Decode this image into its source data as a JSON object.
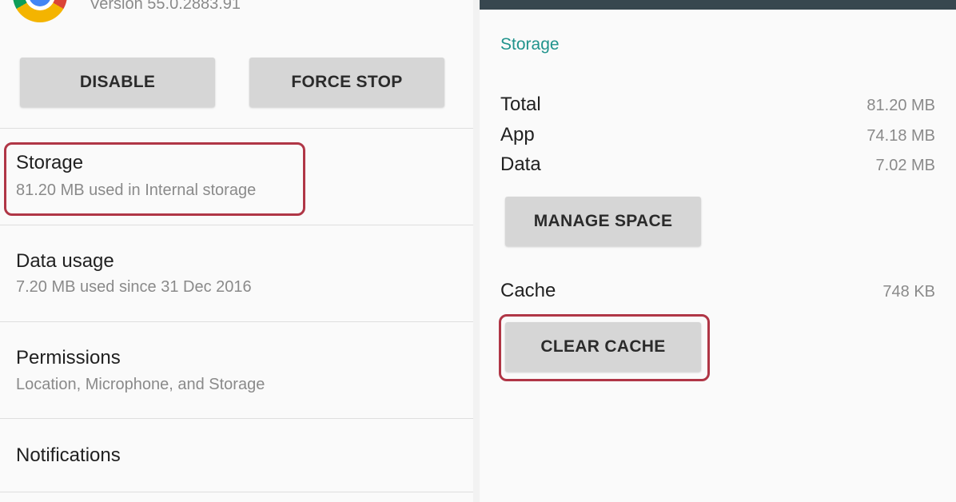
{
  "app_info": {
    "version": "Version 55.0.2883.91",
    "icon": "chrome-icon"
  },
  "buttons": {
    "disable": "DISABLE",
    "force_stop": "FORCE STOP"
  },
  "settings_list": [
    {
      "title": "Storage",
      "subtitle": "81.20 MB used in Internal storage"
    },
    {
      "title": "Data usage",
      "subtitle": "7.20 MB used since 31 Dec 2016"
    },
    {
      "title": "Permissions",
      "subtitle": "Location, Microphone, and Storage"
    },
    {
      "title": "Notifications",
      "subtitle": ""
    }
  ],
  "storage_detail": {
    "title": "Storage",
    "rows": [
      {
        "label": "Total",
        "value": "81.20 MB"
      },
      {
        "label": "App",
        "value": "74.18 MB"
      },
      {
        "label": "Data",
        "value": "7.02 MB"
      }
    ],
    "manage_space": "MANAGE SPACE",
    "cache": {
      "label": "Cache",
      "value": "748 KB"
    },
    "clear_cache": "CLEAR CACHE"
  },
  "colors": {
    "accent": "#20938c",
    "highlight": "#b03646",
    "button_bg": "#d6d6d6",
    "topbar": "#37474f"
  }
}
